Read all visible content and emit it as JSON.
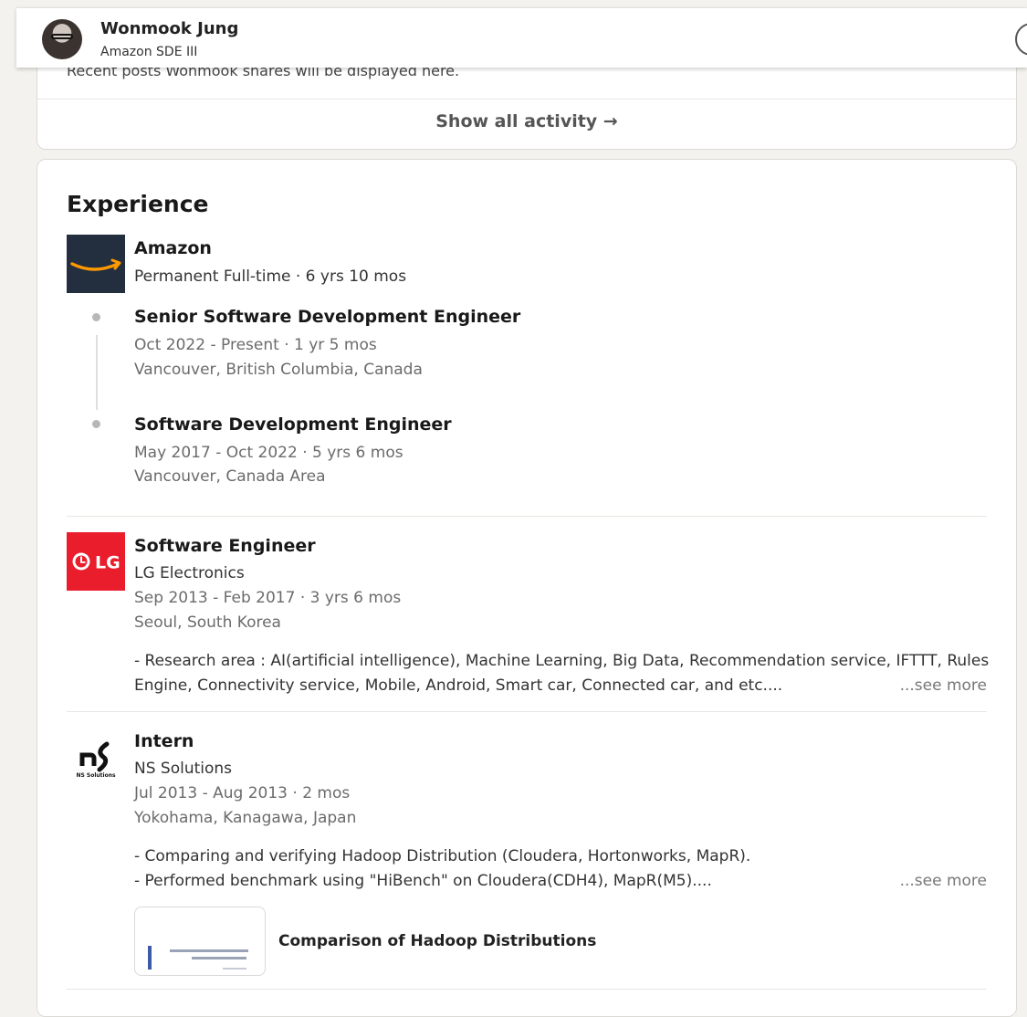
{
  "profile": {
    "name": "Wonmook Jung",
    "headline": "Amazon SDE III"
  },
  "activity": {
    "recent_text": "Recent posts Wonmook shares will be displayed here.",
    "show_all": "Show all activity →"
  },
  "experience": {
    "title": "Experience",
    "amazon": {
      "company": "Amazon",
      "meta": "Permanent Full-time · 6 yrs 10 mos",
      "roles": [
        {
          "title": "Senior Software Development Engineer",
          "dates": "Oct 2022 - Present · 1 yr 5 mos",
          "location": "Vancouver, British Columbia, Canada"
        },
        {
          "title": "Software Development Engineer",
          "dates": "May 2017 - Oct 2022 · 5 yrs 6 mos",
          "location": "Vancouver, Canada Area"
        }
      ]
    },
    "lg": {
      "logo_text": "LG",
      "title": "Software Engineer",
      "company": "LG Electronics",
      "dates": "Sep 2013 - Feb 2017 · 3 yrs 6 mos",
      "location": "Seoul, South Korea",
      "desc_line1": "- Research area : AI(artificial intelligence), Machine Learning, Big Data, Recommendation service, IFTTT, Rules",
      "desc_line2": "Engine, Connectivity service, Mobile, Android, Smart car, Connected car, and etc....",
      "see_more": "...see more"
    },
    "ns": {
      "logo_caption": "NS Solutions",
      "title": "Intern",
      "company": "NS Solutions",
      "dates": "Jul 2013 - Aug 2013 · 2 mos",
      "location": "Yokohama, Kanagawa, Japan",
      "desc_line1": "- Comparing and verifying Hadoop Distribution (Cloudera, Hortonworks, MapR).",
      "desc_line2": "- Performed benchmark using \"HiBench\" on Cloudera(CDH4), MapR(M5)....",
      "see_more": "...see more",
      "media_title": "Comparison of Hadoop Distributions"
    }
  }
}
